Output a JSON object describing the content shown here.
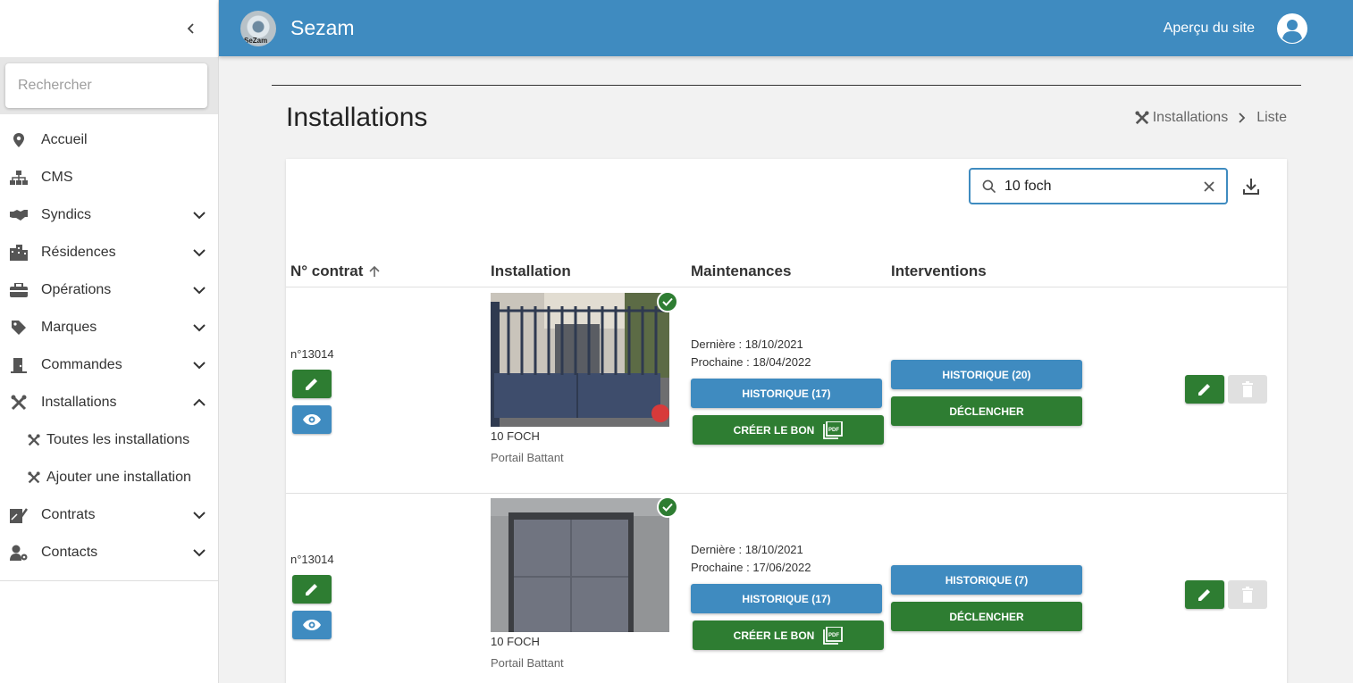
{
  "sidebar": {
    "search_placeholder": "Rechercher",
    "items": [
      {
        "label": "Accueil",
        "icon": "map-pin-icon",
        "expandable": false
      },
      {
        "label": "CMS",
        "icon": "sitemap-icon",
        "expandable": false
      },
      {
        "label": "Syndics",
        "icon": "handshake-icon",
        "expandable": true
      },
      {
        "label": "Résidences",
        "icon": "building-icon",
        "expandable": true
      },
      {
        "label": "Opérations",
        "icon": "toolbox-icon",
        "expandable": true
      },
      {
        "label": "Marques",
        "icon": "tag-icon",
        "expandable": true
      },
      {
        "label": "Commandes",
        "icon": "door-icon",
        "expandable": true
      },
      {
        "label": "Installations",
        "icon": "tools-icon",
        "expandable": true,
        "expanded": true
      },
      {
        "label": "Contrats",
        "icon": "contract-icon",
        "expandable": true
      },
      {
        "label": "Contacts",
        "icon": "user-cog-icon",
        "expandable": true
      }
    ],
    "sub_items": [
      {
        "label": "Toutes les installations",
        "icon": "tools-icon"
      },
      {
        "label": "Ajouter une installation",
        "icon": "tools-icon"
      }
    ]
  },
  "header": {
    "app_name": "Sezam",
    "logo_text": "SeZam",
    "preview_label": "Aperçu du site"
  },
  "page": {
    "title": "Installations",
    "breadcrumb": [
      "Installations",
      "Liste"
    ]
  },
  "table": {
    "search_value": "10 foch",
    "columns": [
      "N° contrat",
      "Installation",
      "Maintenances",
      "Interventions"
    ],
    "rows": [
      {
        "contract": "n°13014",
        "name": "10 FOCH",
        "type": "Portail Battant",
        "last": "Dernière : 18/10/2021",
        "next": "Prochaine : 18/04/2022",
        "maint_history": "HISTORIQUE (17)",
        "create_bon": "CRÉER LE BON",
        "interv_history": "HISTORIQUE (20)",
        "trigger": "DÉCLENCHER",
        "photo": "gate"
      },
      {
        "contract": "n°13014",
        "name": "10 FOCH",
        "type": "Portail Battant",
        "last": "Dernière : 18/10/2021",
        "next": "Prochaine : 17/06/2022",
        "maint_history": "HISTORIQUE (17)",
        "create_bon": "CRÉER LE BON",
        "interv_history": "HISTORIQUE (7)",
        "trigger": "DÉCLENCHER",
        "photo": "garage-door"
      }
    ]
  },
  "colors": {
    "primary": "#3f8bc0",
    "success": "#2e7d32",
    "disabled": "#e0e0e0"
  }
}
